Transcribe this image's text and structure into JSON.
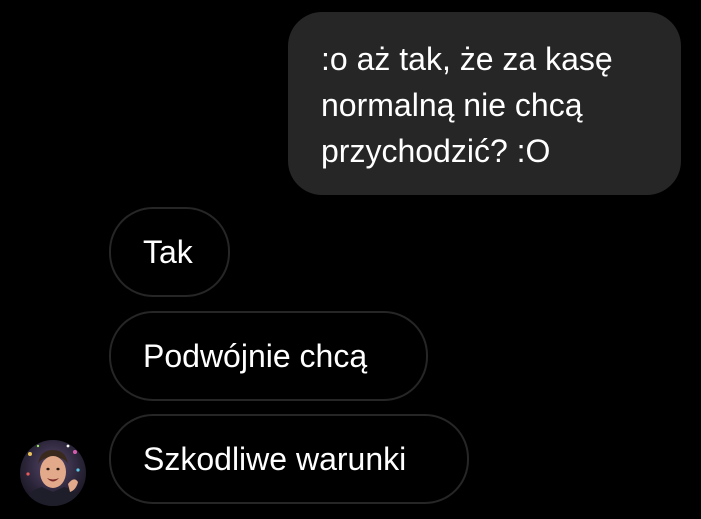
{
  "conversation": {
    "sent_message": {
      "lines": [
        ":o aż tak, że za kasę",
        "normalną nie chcą",
        "przychodzić? :O"
      ]
    },
    "received_messages": [
      {
        "text": "Tak"
      },
      {
        "text": "Podwójnie chcą"
      },
      {
        "text": "Szkodliwe warunki"
      }
    ],
    "avatar_icon": "contact-avatar-photo"
  },
  "colors": {
    "background": "#000000",
    "sent_bubble": "#262626",
    "received_border": "#262626",
    "text": "#ffffff"
  }
}
